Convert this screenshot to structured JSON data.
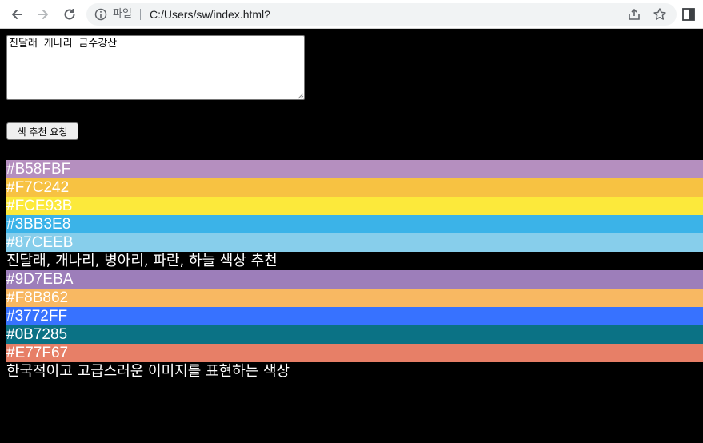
{
  "browser": {
    "scheme_label": "파일",
    "url": "C:/Users/sw/index.html?"
  },
  "page": {
    "input_value": "진달래 개나리 금수강산",
    "button_label": "색 추천 요청"
  },
  "palettes": [
    {
      "colors": [
        "#B58FBF",
        "#F7C242",
        "#FCE93B",
        "#3BB3E8",
        "#87CEEB"
      ],
      "description": "진달래, 개나리, 병아리, 파란, 하늘 색상 추천"
    },
    {
      "colors": [
        "#9D7EBA",
        "#F8B862",
        "#3772FF",
        "#0B7285",
        "#E77F67"
      ],
      "description": "한국적이고 고급스러운 이미지를 표현하는 색상"
    }
  ]
}
